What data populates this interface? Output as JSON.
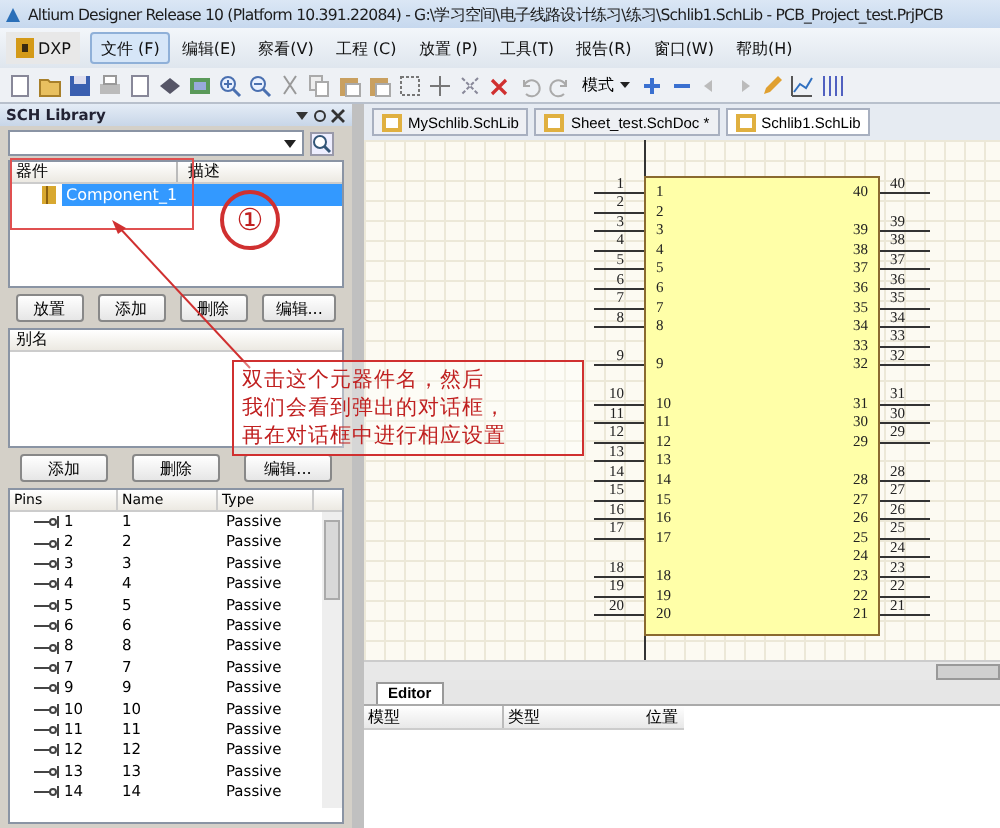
{
  "window": {
    "title": "Altium Designer Release 10 (Platform 10.391.22084) - G:\\学习空间\\电子线路设计练习\\练习\\Schlib1.SchLib - PCB_Project_test.PrjPCB"
  },
  "menu": [
    {
      "label": "DXP",
      "kind": "logo",
      "selected": false
    },
    {
      "label": "文件 (F)",
      "kind": "item",
      "selected": true
    },
    {
      "label": "编辑(E)",
      "kind": "item",
      "selected": false
    },
    {
      "label": "察看(V)",
      "kind": "item",
      "selected": false
    },
    {
      "label": "工程 (C)",
      "kind": "item",
      "selected": false
    },
    {
      "label": "放置 (P)",
      "kind": "item",
      "selected": false
    },
    {
      "label": "工具(T)",
      "kind": "item",
      "selected": false
    },
    {
      "label": "报告(R)",
      "kind": "item",
      "selected": false
    },
    {
      "label": "窗口(W)",
      "kind": "item",
      "selected": false
    },
    {
      "label": "帮助(H)",
      "kind": "item",
      "selected": false
    }
  ],
  "toolbar": {
    "mode_label": "模式"
  },
  "sch_library": {
    "title": "SCH Library",
    "component_columns": [
      "器件",
      "描述"
    ],
    "components": [
      {
        "name": "Component_1",
        "selected": true
      }
    ],
    "component_buttons": [
      "放置",
      "添加",
      "删除",
      "编辑..."
    ],
    "alias_column": "别名",
    "alias_buttons": [
      "添加",
      "删除",
      "编辑..."
    ],
    "pin_columns": [
      "Pins",
      "Name",
      "Type"
    ],
    "pins": [
      {
        "pin": "1",
        "name": "1",
        "type": "Passive"
      },
      {
        "pin": "2",
        "name": "2",
        "type": "Passive"
      },
      {
        "pin": "3",
        "name": "3",
        "type": "Passive"
      },
      {
        "pin": "4",
        "name": "4",
        "type": "Passive"
      },
      {
        "pin": "5",
        "name": "5",
        "type": "Passive"
      },
      {
        "pin": "6",
        "name": "6",
        "type": "Passive"
      },
      {
        "pin": "8",
        "name": "8",
        "type": "Passive"
      },
      {
        "pin": "7",
        "name": "7",
        "type": "Passive"
      },
      {
        "pin": "9",
        "name": "9",
        "type": "Passive"
      },
      {
        "pin": "10",
        "name": "10",
        "type": "Passive"
      },
      {
        "pin": "11",
        "name": "11",
        "type": "Passive"
      },
      {
        "pin": "12",
        "name": "12",
        "type": "Passive"
      },
      {
        "pin": "13",
        "name": "13",
        "type": "Passive"
      },
      {
        "pin": "14",
        "name": "14",
        "type": "Passive"
      }
    ]
  },
  "doc_tabs": [
    {
      "label": "MySchlib.SchLib",
      "selected": false
    },
    {
      "label": "Sheet_test.SchDoc *",
      "selected": false
    },
    {
      "label": "Schlib1.SchLib",
      "selected": true
    }
  ],
  "schematic": {
    "left_pins": [
      {
        "number": "1",
        "name": "1"
      },
      {
        "number": "2",
        "name": "2"
      },
      {
        "number": "3",
        "name": "3"
      },
      {
        "number": "4",
        "name": "4"
      },
      {
        "number": "5",
        "name": "5"
      },
      {
        "number": "6",
        "name": "6"
      },
      {
        "number": "7",
        "name": "7"
      },
      {
        "number": "8",
        "name": "8"
      },
      {
        "number": "9",
        "name": "9"
      },
      {
        "number": "10",
        "name": "10"
      },
      {
        "number": "11",
        "name": "11"
      },
      {
        "number": "12",
        "name": "12"
      },
      {
        "number": "13",
        "name": "13"
      },
      {
        "number": "14",
        "name": "14"
      },
      {
        "number": "15",
        "name": "15"
      },
      {
        "number": "16",
        "name": "16"
      },
      {
        "number": "17",
        "name": "17"
      },
      {
        "number": "18",
        "name": "18"
      },
      {
        "number": "19",
        "name": "19"
      },
      {
        "number": "20",
        "name": "20"
      }
    ],
    "right_pins": [
      {
        "number": "40",
        "name": "40"
      },
      {
        "number": "39",
        "name": "39"
      },
      {
        "number": "38",
        "name": "38"
      },
      {
        "number": "37",
        "name": "37"
      },
      {
        "number": "36",
        "name": "36"
      },
      {
        "number": "35",
        "name": "35"
      },
      {
        "number": "34",
        "name": "34"
      },
      {
        "number": "33",
        "name": "33"
      },
      {
        "number": "32",
        "name": "32"
      },
      {
        "number": "31",
        "name": "31"
      },
      {
        "number": "30",
        "name": "30"
      },
      {
        "number": "29",
        "name": "29"
      },
      {
        "number": "28",
        "name": "28"
      },
      {
        "number": "27",
        "name": "27"
      },
      {
        "number": "26",
        "name": "26"
      },
      {
        "number": "25",
        "name": "25"
      },
      {
        "number": "24",
        "name": "24"
      },
      {
        "number": "23",
        "name": "23"
      },
      {
        "number": "22",
        "name": "22"
      },
      {
        "number": "21",
        "name": "21"
      }
    ]
  },
  "editor": {
    "tab": "Editor",
    "columns": [
      "模型",
      "类型",
      "位置"
    ]
  },
  "annotation": {
    "marker": "①",
    "callout": [
      "双击这个元器件名，然后",
      "我们会看到弹出的对话框，",
      "再在对话框中进行相应设置"
    ]
  }
}
